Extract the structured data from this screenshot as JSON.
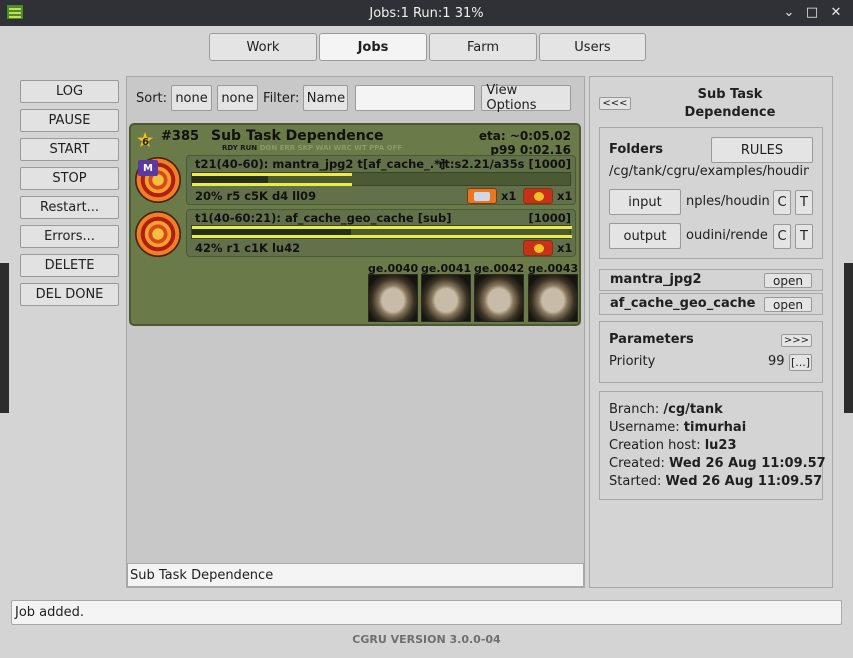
{
  "window": {
    "title": "Jobs:1 Run:1 31%"
  },
  "tabs": [
    "Work",
    "Jobs",
    "Farm",
    "Users"
  ],
  "left_buttons": [
    "LOG",
    "PAUSE",
    "START",
    "STOP",
    "Restart...",
    "Errors...",
    "DELETE",
    "DEL DONE"
  ],
  "sortbar": {
    "sort_label": "Sort:",
    "sort1": "none",
    "sort2": "none",
    "filter_label": "Filter:",
    "filter_field": "Name",
    "filter_value": "",
    "view_options": "View Options"
  },
  "job": {
    "priority_star": "6",
    "id": "#385",
    "name": "Sub Task Dependence",
    "eta": "eta: ~0:05.02",
    "states_active": "RDY RUN",
    "states_inactive": "DON ERR SKP WAI WRC WT PPA OFF",
    "p99": "p99 0:02.16",
    "tasks": [
      {
        "icon_badge": "M",
        "header": "t21(40-60): mantra_jpg2 t[af_cache_.*]",
        "right": "rt:s2.21/a35s [1000]",
        "progress": 0.2,
        "stats": "20% r5 c5K d4 ll09",
        "svc1_count": "x1",
        "svc2_count": "x1"
      },
      {
        "icon_badge": "",
        "header": "t1(40-60:21): af_cache_geo_cache [sub]",
        "right": "[1000]",
        "progress": 0.42,
        "stats": "42% r1 c1K lu42",
        "svc2_count": "x1"
      }
    ],
    "thumbnails": [
      "ge.0040",
      "ge.0041",
      "ge.0042",
      "ge.0043"
    ]
  },
  "center_status": "Sub Task Dependence",
  "right": {
    "collapse_button": "<<<",
    "title": "Sub Task Dependence",
    "folders_label": "Folders",
    "rules_button": "RULES",
    "folder_path": "/cg/tank/cgru/examples/houdin",
    "input_button": "input",
    "input_path": "nples/houdini",
    "output_button": "output",
    "output_path": "oudini/render",
    "c_btn": "C",
    "t_btn": "T",
    "blocks": [
      {
        "name": "mantra_jpg2",
        "button": "open"
      },
      {
        "name": "af_cache_geo_cache",
        "button": "open"
      }
    ],
    "params_label": "Parameters",
    "params_button": ">>>",
    "priority_label": "Priority",
    "priority_value": "99",
    "priority_edit": "[...]",
    "info": {
      "branch_label": "Branch:",
      "branch": "/cg/tank",
      "username_label": "Username:",
      "username": "timurhai",
      "host_label": "Creation host:",
      "host": "lu23",
      "created_label": "Created:",
      "created": "Wed 26 Aug 11:09.57",
      "started_label": "Started:",
      "started": "Wed 26 Aug 11:09.57"
    }
  },
  "status_bar": "Job added.",
  "version": "CGRU VERSION 3.0.0-04",
  "colors": {
    "job_bg": "#6a7a48",
    "progress_yellow": "#ecec48",
    "progress_done": "#262e1a"
  }
}
